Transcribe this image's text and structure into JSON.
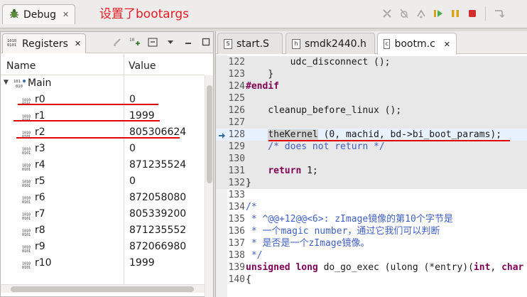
{
  "annotation": {
    "title": "设置了bootargs",
    "color": "#e51c23"
  },
  "debug_view": {
    "tab_label": "Debug",
    "close": "✕"
  },
  "toolbar": {
    "buttons": [
      "disconnect-icon",
      "skip-breakpoints-icon",
      "step-return-icon",
      "resume-icon",
      "suspend-icon",
      "terminate-icon",
      "step-into-icon"
    ]
  },
  "registers": {
    "tab_label": "Registers",
    "close": "✕",
    "col_name": "Name",
    "col_value": "Value",
    "group": "Main",
    "rows": [
      {
        "name": "r0",
        "value": "0"
      },
      {
        "name": "r1",
        "value": "1999"
      },
      {
        "name": "r2",
        "value": "805306624"
      },
      {
        "name": "r3",
        "value": "0"
      },
      {
        "name": "r4",
        "value": "871235524"
      },
      {
        "name": "r5",
        "value": "0"
      },
      {
        "name": "r6",
        "value": "872058080"
      },
      {
        "name": "r7",
        "value": "805339200"
      },
      {
        "name": "r8",
        "value": "871235552"
      },
      {
        "name": "r9",
        "value": "872066980"
      },
      {
        "name": "r10",
        "value": "1999"
      }
    ]
  },
  "editor": {
    "tabs": [
      {
        "label": "start.S",
        "icon": "S",
        "active": false
      },
      {
        "label": "smdk2440.h",
        "icon": "h",
        "active": false
      },
      {
        "label": "bootm.c",
        "icon": "c",
        "active": true
      }
    ],
    "close": "✕",
    "lines": [
      {
        "n": "122",
        "text": "        udc_disconnect ();"
      },
      {
        "n": "123",
        "text": "    }"
      },
      {
        "n": "124",
        "text": "#endif"
      },
      {
        "n": "125",
        "text": ""
      },
      {
        "n": "126",
        "text": "    cleanup_before_linux ();"
      },
      {
        "n": "127",
        "text": ""
      },
      {
        "n": "128",
        "text": "    theKernel (0, machid, bd->bi_boot_params);"
      },
      {
        "n": "129",
        "text": "    /* does not return */"
      },
      {
        "n": "130",
        "text": ""
      },
      {
        "n": "131",
        "text": "    return 1;"
      },
      {
        "n": "132",
        "text": "}"
      },
      {
        "n": "133",
        "text": ""
      },
      {
        "n": "134",
        "text": "/*"
      },
      {
        "n": "135",
        "text": " * ^@@+12@@<6>: zImage镜像的第10个字节是"
      },
      {
        "n": "136",
        "text": " * 一个magic number，通过它我们可以判断"
      },
      {
        "n": "137",
        "text": " * 是否是一个zImage镜像。"
      },
      {
        "n": "138",
        "text": " */"
      },
      {
        "n": "139",
        "text": "unsigned long do_go_exec (ulong (*entry)(int, char"
      },
      {
        "n": "140",
        "text": "{"
      }
    ]
  }
}
